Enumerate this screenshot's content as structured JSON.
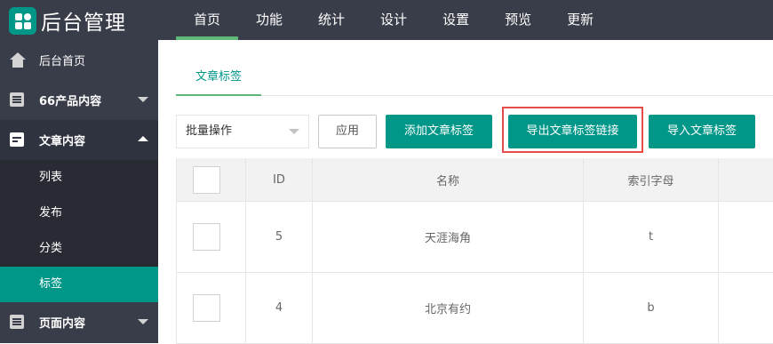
{
  "app": {
    "logo_text": "后台管理",
    "logo_icon": "grid-logo-icon"
  },
  "nav": {
    "items": [
      {
        "label": "首页",
        "active": true
      },
      {
        "label": "功能"
      },
      {
        "label": "统计"
      },
      {
        "label": "设计"
      },
      {
        "label": "设置"
      },
      {
        "label": "预览"
      },
      {
        "label": "更新"
      }
    ]
  },
  "sidebar": {
    "home": {
      "label": "后台首页",
      "icon": "home-icon"
    },
    "products": {
      "label": "66产品内容",
      "icon": "list-icon"
    },
    "articles": {
      "label": "文章内容",
      "icon": "article-icon",
      "items": [
        {
          "label": "列表"
        },
        {
          "label": "发布"
        },
        {
          "label": "分类"
        },
        {
          "label": "标签",
          "active": true
        }
      ]
    },
    "pages": {
      "label": "页面内容",
      "icon": "page-icon"
    }
  },
  "tabs": [
    {
      "label": "文章标签",
      "active": true
    }
  ],
  "toolbar": {
    "batch_select": "批量操作",
    "apply": "应用",
    "add_tag": "添加文章标签",
    "export_links": "导出文章标签链接",
    "import_tags": "导入文章标签"
  },
  "table": {
    "headers": {
      "id": "ID",
      "name": "名称",
      "index": "索引字母"
    },
    "rows": [
      {
        "id": "5",
        "name": "天涯海角",
        "index": "t"
      },
      {
        "id": "4",
        "name": "北京有约",
        "index": "b"
      }
    ]
  },
  "colors": {
    "topbar": "#393d49",
    "accent": "#009688",
    "active_underline": "#5fb878",
    "highlight": "#e74c4c"
  }
}
